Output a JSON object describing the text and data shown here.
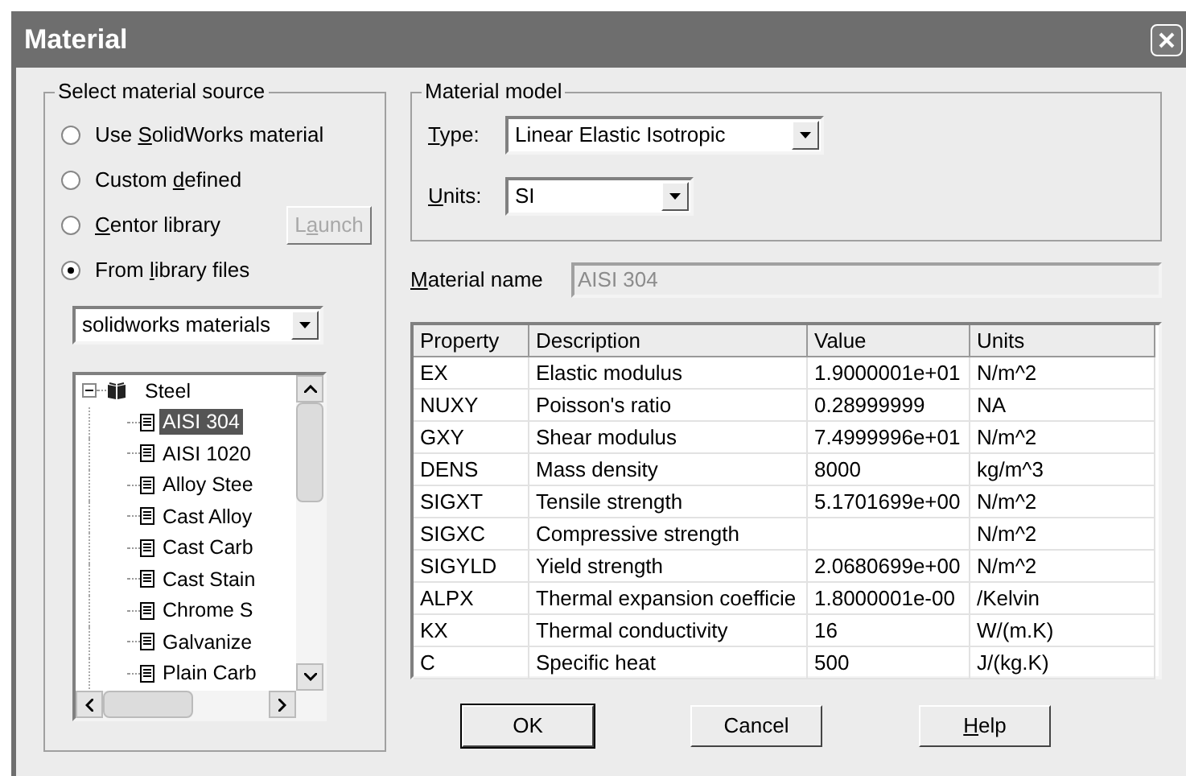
{
  "window": {
    "title": "Material"
  },
  "source_group": {
    "title": "Select material source",
    "options": [
      {
        "label": {
          "text": "Use ",
          "key": "S",
          "rest": "olidWorks material"
        },
        "selected": false
      },
      {
        "label": {
          "text": "Custom ",
          "key": "d",
          "rest": "efined"
        },
        "selected": false
      },
      {
        "label": {
          "key": "C",
          "rest": "entor library"
        },
        "selected": false,
        "button": {
          "label": {
            "text": "L",
            "key": "a",
            "rest": "unch"
          },
          "disabled": true
        }
      },
      {
        "label": {
          "text": "From ",
          "key": "l",
          "rest": "ibrary files"
        },
        "selected": true
      }
    ],
    "library_select": {
      "value": "solidworks materials"
    },
    "tree": [
      {
        "label": "Steel",
        "expanded": true,
        "children": [
          {
            "label": "AISI 304",
            "selected": true
          },
          {
            "label": "AISI 1020",
            "selected": false
          },
          {
            "label": "Alloy Stee",
            "selected": false
          },
          {
            "label": "Cast Alloy",
            "selected": false
          },
          {
            "label": "Cast Carb",
            "selected": false
          },
          {
            "label": "Cast Stain",
            "selected": false
          },
          {
            "label": "Chrome S",
            "selected": false
          },
          {
            "label": "Galvanize",
            "selected": false
          },
          {
            "label": "Plain Carb",
            "selected": false
          }
        ]
      }
    ]
  },
  "model_group": {
    "title": "Material model",
    "type": {
      "label": {
        "key": "T",
        "rest": "ype:"
      },
      "value": "Linear Elastic Isotropic"
    },
    "units": {
      "label": {
        "key": "U",
        "rest": "nits:"
      },
      "value": "SI"
    }
  },
  "material_name": {
    "label": {
      "key": "M",
      "rest": "aterial name"
    },
    "value": "AISI 304",
    "disabled": true
  },
  "table": {
    "columns": [
      "Property",
      "Description",
      "Value",
      "Units"
    ],
    "rows": [
      {
        "property": "EX",
        "description": "Elastic modulus",
        "value": "1.9000001e+01",
        "units": "N/m^2"
      },
      {
        "property": "NUXY",
        "description": "Poisson's ratio",
        "value": "0.28999999",
        "units": "NA"
      },
      {
        "property": "GXY",
        "description": "Shear modulus",
        "value": "7.4999996e+01",
        "units": "N/m^2"
      },
      {
        "property": "DENS",
        "description": "Mass density",
        "value": "8000",
        "units": "kg/m^3"
      },
      {
        "property": "SIGXT",
        "description": "Tensile strength",
        "value": "5.1701699e+00",
        "units": "N/m^2"
      },
      {
        "property": "SIGXC",
        "description": "Compressive strength",
        "units": "N/m^2"
      },
      {
        "property": "SIGYLD",
        "description": "Yield strength",
        "value": "2.0680699e+00",
        "units": "N/m^2"
      },
      {
        "property": "ALPX",
        "description": "Thermal expansion coefficie",
        "value": "1.8000001e-00",
        "units": "/Kelvin"
      },
      {
        "property": "KX",
        "description": "Thermal conductivity",
        "value": "16",
        "units": "W/(m.K)"
      },
      {
        "property": "C",
        "description": "Specific heat",
        "value": "500",
        "units": "J/(kg.K)"
      }
    ]
  },
  "buttons": [
    {
      "label": {
        "text": "OK"
      }
    },
    {
      "label": {
        "text": "Cancel"
      }
    },
    {
      "label": {
        "key": "H",
        "rest": "elp"
      }
    }
  ]
}
